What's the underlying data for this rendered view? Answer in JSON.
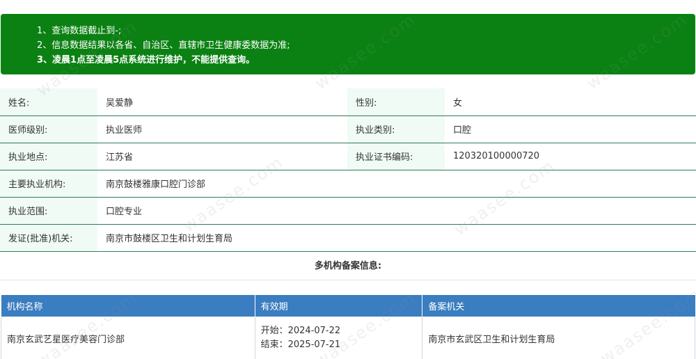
{
  "notice": {
    "lines": [
      "1、查询数据截止到-;",
      "2、信息数据结果以各省、自治区、直辖市卫生健康委数据为准;",
      "3、凌晨1点至凌晨5点系统进行维护，不能提供查询。"
    ]
  },
  "info": {
    "name_label": "姓名:",
    "name_value": "吴爱静",
    "gender_label": "性别:",
    "gender_value": "女",
    "level_label": "医师级别:",
    "level_value": "执业医师",
    "category_label": "执业类别:",
    "category_value": "口腔",
    "location_label": "执业地点:",
    "location_value": "江苏省",
    "cert_label": "执业证书编码:",
    "cert_value": "120320100000720",
    "org_label": "主要执业机构:",
    "org_value": "南京鼓楼雅康口腔门诊部",
    "scope_label": "执业范围:",
    "scope_value": "口腔专业",
    "issuer_label": "发证(批准)机关:",
    "issuer_value": "南京市鼓楼区卫生和计划生育局"
  },
  "multi_org": {
    "title": "多机构备案信息:",
    "headers": [
      "机构名称",
      "有效期",
      "备案机关"
    ],
    "rows": [
      {
        "name": "南京玄武艺星医疗美容门诊部",
        "start": "开始：2024-07-22",
        "end": "结束：2025-07-21",
        "authority": "南京市玄武区卫生和计划生育局"
      }
    ]
  },
  "watermark": "waasee.com"
}
